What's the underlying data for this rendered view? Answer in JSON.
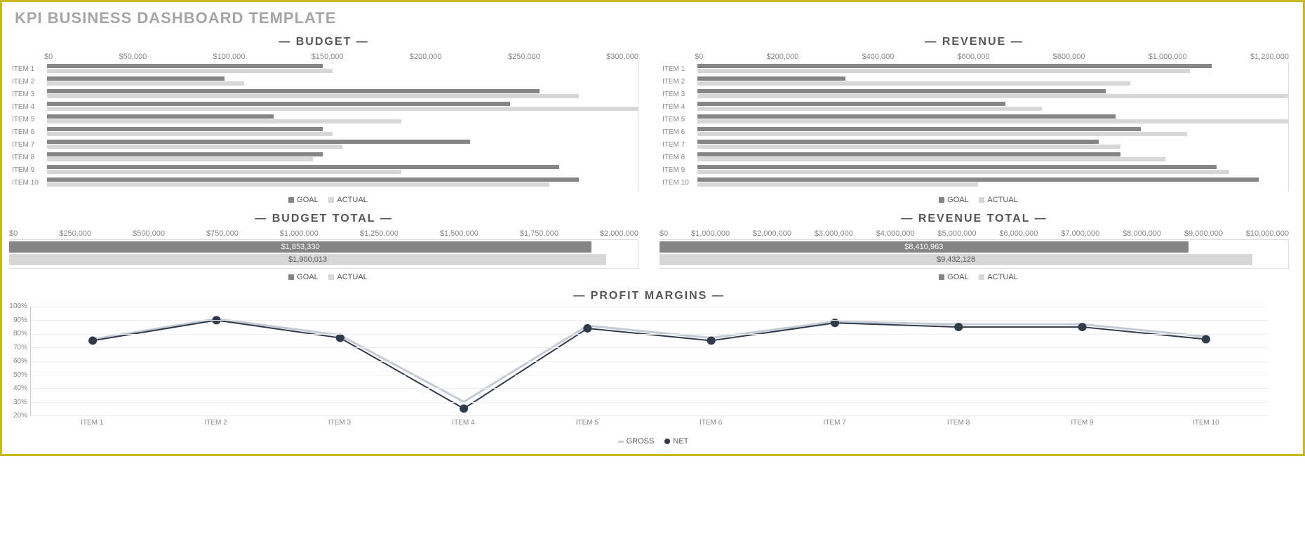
{
  "title": "KPI BUSINESS DASHBOARD TEMPLATE",
  "legend": {
    "goal": "GOAL",
    "actual": "ACTUAL",
    "gross": "GROSS",
    "net": "NET"
  },
  "chart_data": [
    {
      "id": "budget",
      "type": "bar",
      "orientation": "horizontal",
      "title": "— BUDGET —",
      "xlabel": "",
      "ylabel": "",
      "xlim": [
        0,
        300000
      ],
      "xticks": [
        "$0",
        "$50,000",
        "$100,000",
        "$150,000",
        "$200,000",
        "$250,000",
        "$300,000"
      ],
      "categories": [
        "ITEM 1",
        "ITEM 2",
        "ITEM 3",
        "ITEM 4",
        "ITEM 5",
        "ITEM 6",
        "ITEM 7",
        "ITEM 8",
        "ITEM 9",
        "ITEM 10"
      ],
      "series": [
        {
          "name": "GOAL",
          "color": "#858585",
          "values": [
            140000,
            90000,
            250000,
            235000,
            115000,
            140000,
            215000,
            140000,
            260000,
            270000
          ]
        },
        {
          "name": "ACTUAL",
          "color": "#d7d7d7",
          "values": [
            145000,
            100000,
            270000,
            300000,
            180000,
            145000,
            150000,
            135000,
            180000,
            255000
          ]
        }
      ],
      "legend_position": "bottom"
    },
    {
      "id": "revenue",
      "type": "bar",
      "orientation": "horizontal",
      "title": "— REVENUE —",
      "xlabel": "",
      "ylabel": "",
      "xlim": [
        0,
        1200000
      ],
      "xticks": [
        "$0",
        "$200,000",
        "$400,000",
        "$600,000",
        "$800,000",
        "$1,000,000",
        "$1,200,000"
      ],
      "categories": [
        "ITEM 1",
        "ITEM 2",
        "ITEM 3",
        "ITEM 4",
        "ITEM 5",
        "ITEM 6",
        "ITEM 7",
        "ITEM 8",
        "ITEM 9",
        "ITEM 10"
      ],
      "series": [
        {
          "name": "GOAL",
          "color": "#858585",
          "values": [
            1045000,
            300000,
            830000,
            625000,
            850000,
            900000,
            815000,
            860000,
            1055000,
            1140000
          ]
        },
        {
          "name": "ACTUAL",
          "color": "#d7d7d7",
          "values": [
            1000000,
            880000,
            1200000,
            700000,
            1200000,
            995000,
            860000,
            950000,
            1080000,
            570000
          ]
        }
      ],
      "legend_position": "bottom"
    },
    {
      "id": "budget_total",
      "type": "bar",
      "orientation": "horizontal",
      "title": "— BUDGET TOTAL —",
      "xlim": [
        0,
        2000000
      ],
      "xticks": [
        "$0",
        "$250,000",
        "$500,000",
        "$750,000",
        "$1,000,000",
        "$1,250,000",
        "$1,500,000",
        "$1,750,000",
        "$2,000,000"
      ],
      "categories": [
        "TOTAL"
      ],
      "series": [
        {
          "name": "GOAL",
          "color": "#858585",
          "values": [
            1853330
          ],
          "labels": [
            "$1,853,330"
          ]
        },
        {
          "name": "ACTUAL",
          "color": "#d7d7d7",
          "values": [
            1900013
          ],
          "labels": [
            "$1,900,013"
          ]
        }
      ],
      "legend_position": "bottom"
    },
    {
      "id": "revenue_total",
      "type": "bar",
      "orientation": "horizontal",
      "title": "— REVENUE TOTAL —",
      "xlim": [
        0,
        10000000
      ],
      "xticks": [
        "$0",
        "$1,000,000",
        "$2,000,000",
        "$3,000,000",
        "$4,000,000",
        "$5,000,000",
        "$6,000,000",
        "$7,000,000",
        "$8,000,000",
        "$9,000,000",
        "$10,000,000"
      ],
      "categories": [
        "TOTAL"
      ],
      "series": [
        {
          "name": "GOAL",
          "color": "#858585",
          "values": [
            8410963
          ],
          "labels": [
            "$8,410,963"
          ]
        },
        {
          "name": "ACTUAL",
          "color": "#d7d7d7",
          "values": [
            9432128
          ],
          "labels": [
            "$9,432,128"
          ]
        }
      ],
      "legend_position": "bottom"
    },
    {
      "id": "profit_margins",
      "type": "line",
      "title": "— PROFIT MARGINS —",
      "ylim": [
        20,
        100
      ],
      "yticks": [
        "100%",
        "90%",
        "80%",
        "70%",
        "60%",
        "50%",
        "40%",
        "30%",
        "20%"
      ],
      "categories": [
        "ITEM 1",
        "ITEM 2",
        "ITEM 3",
        "ITEM 4",
        "ITEM 5",
        "ITEM 6",
        "ITEM 7",
        "ITEM 8",
        "ITEM 9",
        "ITEM 10"
      ],
      "series": [
        {
          "name": "GROSS",
          "color": "#c4cbd7",
          "values": [
            76,
            91,
            79,
            30,
            86,
            77,
            89,
            87,
            87,
            78
          ]
        },
        {
          "name": "NET",
          "color": "#2f3a4a",
          "values": [
            75,
            90,
            77,
            25,
            84,
            75,
            88,
            85,
            85,
            76
          ]
        }
      ],
      "legend_position": "bottom"
    }
  ]
}
